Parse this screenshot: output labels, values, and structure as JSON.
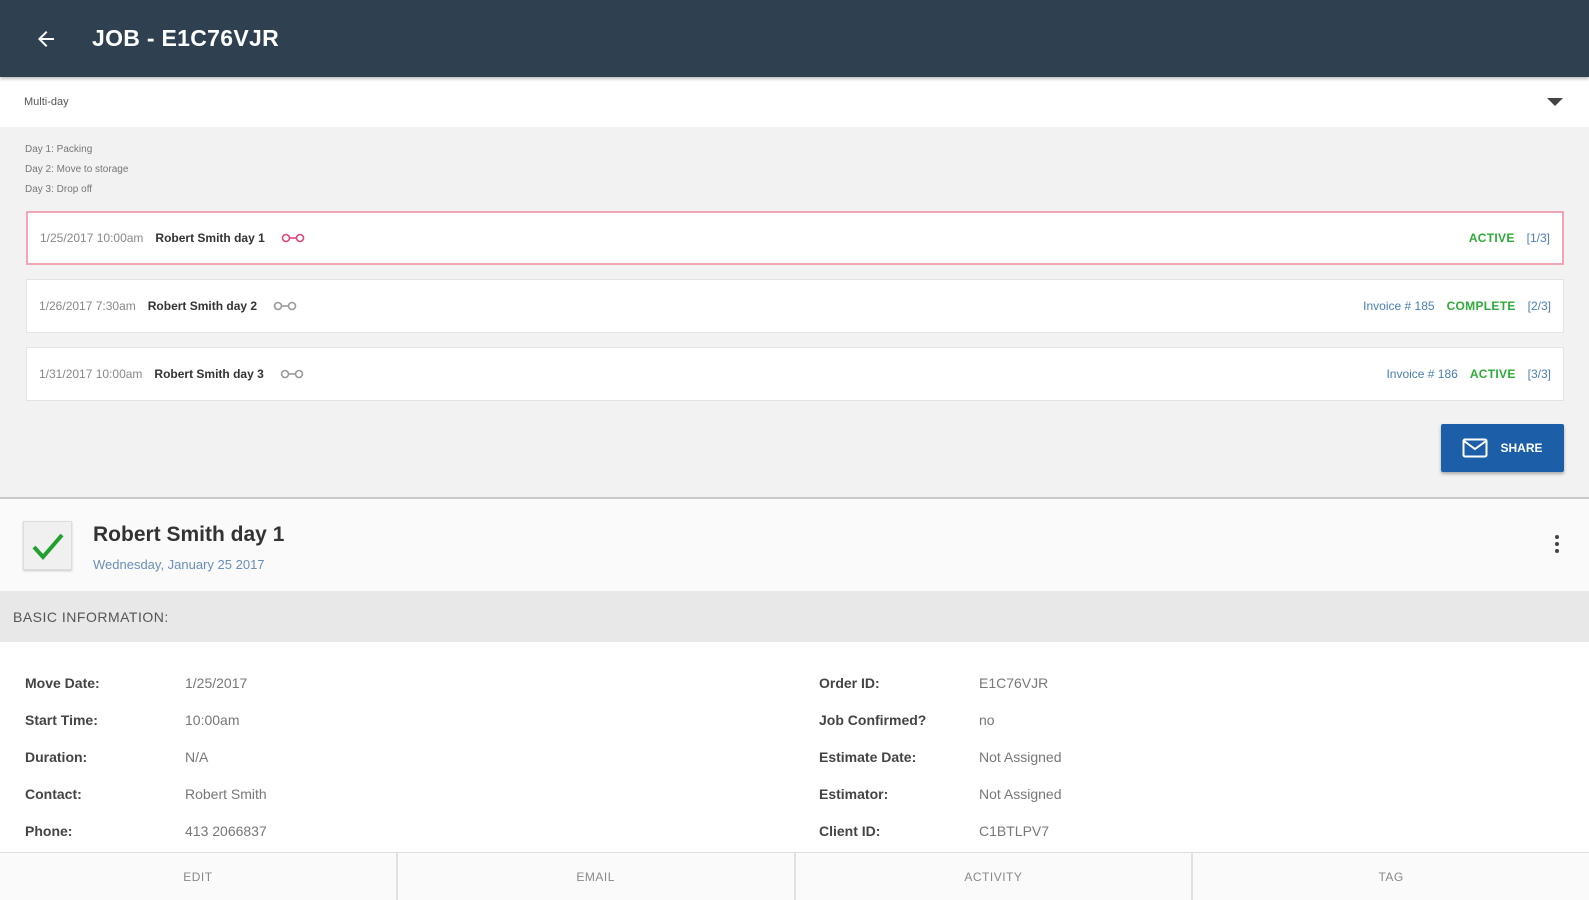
{
  "appbar": {
    "title": "JOB - E1C76VJR",
    "back_icon": "arrow-left-icon"
  },
  "mode": {
    "label": "Multi-day"
  },
  "notes": [
    "Day 1: Packing",
    "Day 2: Move to storage",
    "Day 3: Drop off"
  ],
  "days": [
    {
      "date": "1/25/2017 10:00am",
      "name": "Robert Smith day 1",
      "invoice": "",
      "status": "ACTIVE",
      "count": "[1/3]"
    },
    {
      "date": "1/26/2017 7:30am",
      "name": "Robert Smith day 2",
      "invoice": "Invoice # 185",
      "status": "COMPLETE",
      "count": "[2/3]"
    },
    {
      "date": "1/31/2017 10:00am",
      "name": "Robert Smith day 3",
      "invoice": "Invoice # 186",
      "status": "ACTIVE",
      "count": "[3/3]"
    }
  ],
  "share": {
    "label": "SHARE"
  },
  "job": {
    "title": "Robert Smith day 1",
    "date": "Wednesday, January 25 2017"
  },
  "section": {
    "title": "BASIC INFORMATION:"
  },
  "info_left": [
    {
      "label": "Move Date:",
      "value": "1/25/2017"
    },
    {
      "label": "Start Time:",
      "value": "10:00am"
    },
    {
      "label": "Duration:",
      "value": "N/A"
    },
    {
      "label": "Contact:",
      "value": "Robert Smith"
    },
    {
      "label": "Phone:",
      "value": "413 2066837"
    }
  ],
  "info_right": [
    {
      "label": "Order ID:",
      "value": "E1C76VJR"
    },
    {
      "label": "Job Confirmed?",
      "value": "no"
    },
    {
      "label": "Estimate Date:",
      "value": "Not Assigned"
    },
    {
      "label": "Estimator:",
      "value": "Not Assigned"
    },
    {
      "label": "Client ID:",
      "value": "C1BTLPV7"
    }
  ],
  "bottom_tabs": [
    "EDIT",
    "EMAIL",
    "ACTIVITY",
    "TAG"
  ],
  "colors": {
    "appbar": "#2f4050",
    "active": "#2eaa3a",
    "link": "#4a7fb5",
    "share": "#1d5ea8",
    "selected_border": "#f2a6b3"
  }
}
